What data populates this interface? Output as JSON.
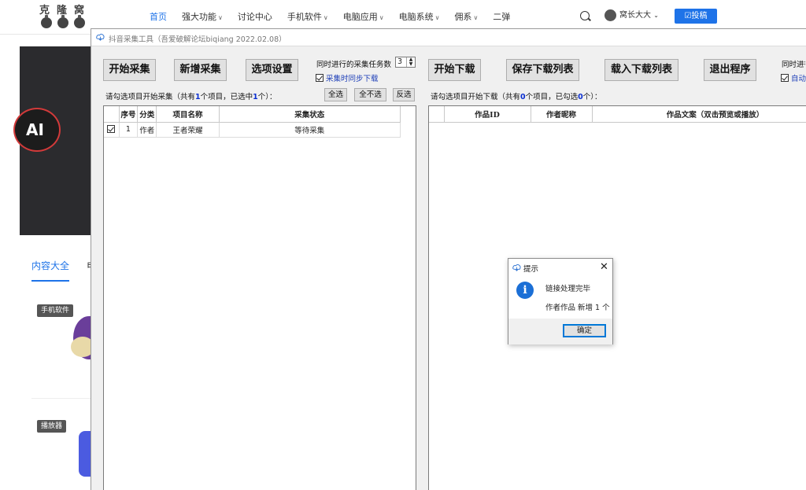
{
  "site": {
    "logo_text": "克隆窝",
    "nav": [
      {
        "label": "首页",
        "active": true,
        "has_menu": false
      },
      {
        "label": "强大功能",
        "has_menu": true
      },
      {
        "label": "讨论中心",
        "has_menu": false
      },
      {
        "label": "手机软件",
        "has_menu": true
      },
      {
        "label": "电脑应用",
        "has_menu": true
      },
      {
        "label": "电脑系统",
        "has_menu": true
      },
      {
        "label": "佣系",
        "has_menu": true
      },
      {
        "label": "二弹",
        "has_menu": false
      }
    ],
    "user_name": "窝长大大",
    "post_button": "☑投稿",
    "content_tab": "内容大全",
    "content_tab2": "电",
    "tag_mobile": "手机软件",
    "tag_player": "播放器"
  },
  "window": {
    "title": "抖音采集工具（吾爱破解论坛biqiang 2022.02.08）",
    "buttons": {
      "start_collect": "开始采集",
      "add_collect": "新增采集",
      "options": "选项设置",
      "start_download": "开始下载",
      "save_list": "保存下载列表",
      "load_list": "载入下载列表",
      "exit": "退出程序"
    },
    "concurrent_label": "同时进行的采集任务数",
    "concurrent_value": "3",
    "sync_download_label": "采集时同步下载",
    "right_concurrent_label": "同时进行",
    "right_auto_label": "自动",
    "left_info": {
      "prefix": "请勾选项目开始采集（共有",
      "total": "1",
      "middle": "个项目，已选中",
      "selected": "1",
      "suffix": "个）："
    },
    "right_info": {
      "prefix": "请勾选项目开始下载（共有",
      "total": "0",
      "middle": "个项目，已勾选",
      "selected": "0",
      "suffix": "个）："
    },
    "select_all": "全选",
    "select_none": "全不选",
    "invert": "反选",
    "left_table": {
      "headers": [
        "",
        "序号",
        "分类",
        "项目名称",
        "采集状态"
      ],
      "rows": [
        {
          "checked": true,
          "index": "1",
          "category": "作者",
          "name": "王者荣耀",
          "status": "等待采集"
        }
      ]
    },
    "right_table": {
      "headers": [
        "",
        "作品ID",
        "作者昵称",
        "作品文案（双击预览或播放）"
      ],
      "rows": []
    }
  },
  "dialog": {
    "title": "提示",
    "message1": "链接处理完毕",
    "message2": "作者作品 新增 1 个",
    "ok": "确定"
  }
}
